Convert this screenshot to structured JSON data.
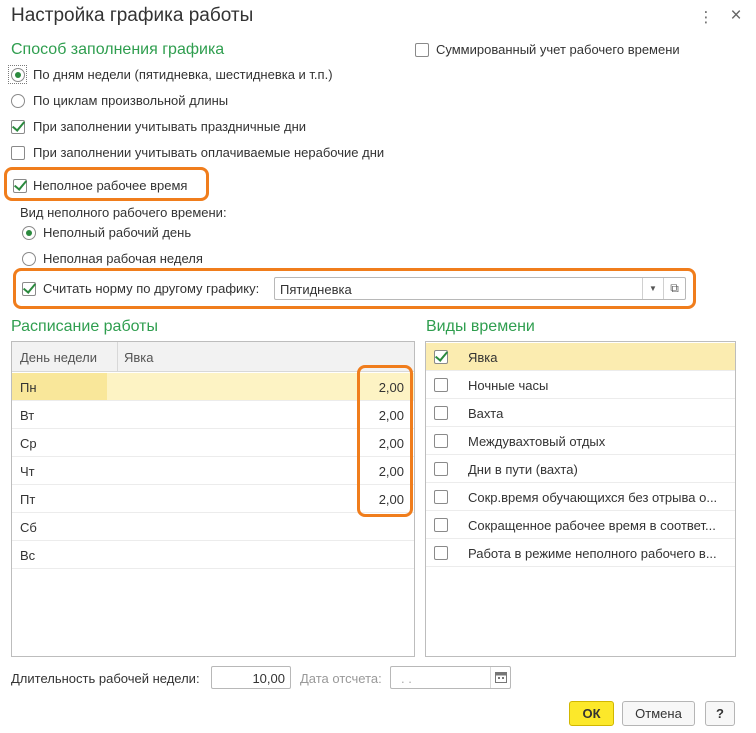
{
  "window": {
    "title": "Настройка графика работы",
    "menu_icon": "⋮",
    "close_icon": "×"
  },
  "fill_method": {
    "title": "Способ заполнения графика",
    "options": [
      {
        "label": "По дням недели (пятидневка, шестидневка и т.п.)",
        "checked": true
      },
      {
        "label": "По циклам произвольной длины",
        "checked": false
      }
    ],
    "holidays": {
      "label": "При заполнении учитывать праздничные дни",
      "checked": true
    },
    "paid_nonwork": {
      "label": "При заполнении учитывать оплачиваемые нерабочие дни",
      "checked": false
    }
  },
  "summarized": {
    "label": "Суммированный учет рабочего времени",
    "checked": false
  },
  "parttime": {
    "label": "Неполное рабочее время",
    "checked": true,
    "kind_label": "Вид неполного рабочего времени:",
    "kinds": [
      {
        "label": "Неполный рабочий день",
        "checked": true
      },
      {
        "label": "Неполная рабочая неделя",
        "checked": false
      }
    ],
    "norm": {
      "label": "Считать норму по другому графику:",
      "checked": true,
      "value": "Пятидневка"
    }
  },
  "schedule": {
    "title": "Расписание работы",
    "columns": [
      "День недели",
      "Явка"
    ],
    "rows": [
      {
        "day": "Пн",
        "value": "2,00"
      },
      {
        "day": "Вт",
        "value": "2,00"
      },
      {
        "day": "Ср",
        "value": "2,00"
      },
      {
        "day": "Чт",
        "value": "2,00"
      },
      {
        "day": "Пт",
        "value": "2,00"
      },
      {
        "day": "Сб",
        "value": ""
      },
      {
        "day": "Вс",
        "value": ""
      }
    ]
  },
  "time_types": {
    "title": "Виды времени",
    "items": [
      {
        "label": "Явка",
        "checked": true
      },
      {
        "label": "Ночные часы",
        "checked": false
      },
      {
        "label": "Вахта",
        "checked": false
      },
      {
        "label": "Междувахтовый отдых",
        "checked": false
      },
      {
        "label": "Дни в пути (вахта)",
        "checked": false
      },
      {
        "label": "Сокр.время обучающихся без отрыва о...",
        "checked": false
      },
      {
        "label": "Сокращенное рабочее время в соответ...",
        "checked": false
      },
      {
        "label": "Работа в режиме неполного рабочего в...",
        "checked": false
      }
    ]
  },
  "footer": {
    "week_length_label": "Длительность рабочей недели:",
    "week_length_value": "10,00",
    "ref_date_label": "Дата отсчета:",
    "ref_date_value": ". .",
    "ok": "ОК",
    "cancel": "Отмена",
    "help": "?"
  },
  "colors": {
    "accent_green": "#2f9e4f",
    "highlight_orange": "#f07d1c",
    "primary_button": "#fce82a",
    "selection": "#fbecb0"
  }
}
